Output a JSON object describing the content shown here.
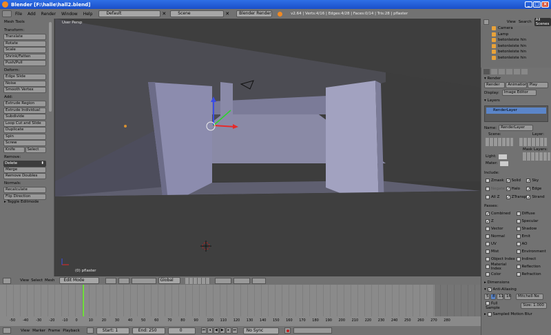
{
  "titlebar": {
    "title": "Blender [F:\\halle\\hall2.blend]"
  },
  "menubar": {
    "items": [
      "File",
      "Add",
      "Render",
      "Window",
      "Help"
    ],
    "layout": "Default",
    "scene": "Scene",
    "engine": "Blender Render",
    "stats": "v2.64 | Verts:4/16 | Edges:4/28 | Faces:0/14 | Tris:28 | pflaster"
  },
  "toolshelf": {
    "title": "Mesh Tools",
    "transform_head": "Transform:",
    "transform": [
      "Translate",
      "Rotate",
      "Scale",
      "Shrink/Fatten",
      "Push/Pull"
    ],
    "deform_head": "Deform:",
    "deform": [
      "Edge Slide",
      "Noise",
      "Smooth Vertex"
    ],
    "add_head": "Add:",
    "add": [
      "Extrude Region",
      "Extrude Individual",
      "Subdivide",
      "Loop Cut and Slide",
      "Duplicate",
      "Spin",
      "Screw"
    ],
    "knife": "Knife",
    "select": "Select",
    "remove_head": "Remove:",
    "delete": "Delete",
    "remove": [
      "Merge",
      "Remove Doubles"
    ],
    "normals_head": "Normals:",
    "recalculate": "Recalculate",
    "flip": "Flip Direction",
    "toggle": "Toggle Editmode"
  },
  "viewport": {
    "label": "User Persp",
    "object": "(0) pflaster"
  },
  "outliner": {
    "view": "View",
    "search": "Search",
    "scenes": "All Scenes",
    "rows": [
      "Camera",
      "Lamp",
      "betonleiste hin",
      "betonleiste hin",
      "betonleiste hin",
      "betonleiste hin"
    ]
  },
  "properties": {
    "render_head": "Render",
    "render_btn": "Render",
    "animation_btn": "Animation",
    "play_btn": "Play",
    "display_label": "Display:",
    "display_value": "Image Editor",
    "layers_head": "Layers",
    "layer_item": "RenderLayer",
    "name_label": "Name:",
    "name_value": "RenderLayer",
    "scene_label": "Scene:",
    "layer_label": "Layer:",
    "mask_label": "Mask Layers:",
    "light_label": "Light:",
    "mat_label": "Mater:",
    "include_head": "Include:",
    "include": [
      [
        "Zmask",
        "Solid",
        "Sky"
      ],
      [
        "Negate",
        "Halo",
        "Edge"
      ],
      [
        "All Z",
        "ZTransp",
        "Strand"
      ]
    ],
    "passes_head": "Passes:",
    "passes": [
      [
        "Combined",
        "Diffuse"
      ],
      [
        "Z",
        "Specular"
      ],
      [
        "Vector",
        "Shadow"
      ],
      [
        "Normal",
        "Emit"
      ],
      [
        "UV",
        "AO"
      ],
      [
        "Mist",
        "Environment"
      ],
      [
        "Object Index",
        "Indirect"
      ],
      [
        "Material Index",
        "Reflection"
      ],
      [
        "Color",
        "Refraction"
      ]
    ],
    "dimensions_head": "Dimensions",
    "aa_head": "Anti-Aliasing",
    "aa_values": [
      "5",
      "8",
      "11",
      "16"
    ],
    "aa_filter": "Mitchell-Ne",
    "full_sample": "Full Sample",
    "size": "Size: 1.000",
    "motion_blur": "Sampled Motion Blur"
  },
  "view_header": {
    "items": [
      "View",
      "Select",
      "Mesh"
    ],
    "mode": "Edit Mode",
    "orientation": "Global"
  },
  "timeline": {
    "ticks": [
      "-50",
      "-40",
      "-30",
      "-20",
      "-10",
      "0",
      "10",
      "20",
      "30",
      "40",
      "50",
      "60",
      "70",
      "80",
      "90",
      "100",
      "110",
      "120",
      "130",
      "140",
      "150",
      "160",
      "170",
      "180",
      "190",
      "200",
      "210",
      "220",
      "230",
      "240",
      "250",
      "260",
      "270",
      "280"
    ]
  },
  "playbar": {
    "items": [
      "View",
      "Marker",
      "Frame",
      "Playback"
    ],
    "start": "Start: 1",
    "end": "End: 250",
    "current": "0",
    "sync": "No Sync"
  }
}
